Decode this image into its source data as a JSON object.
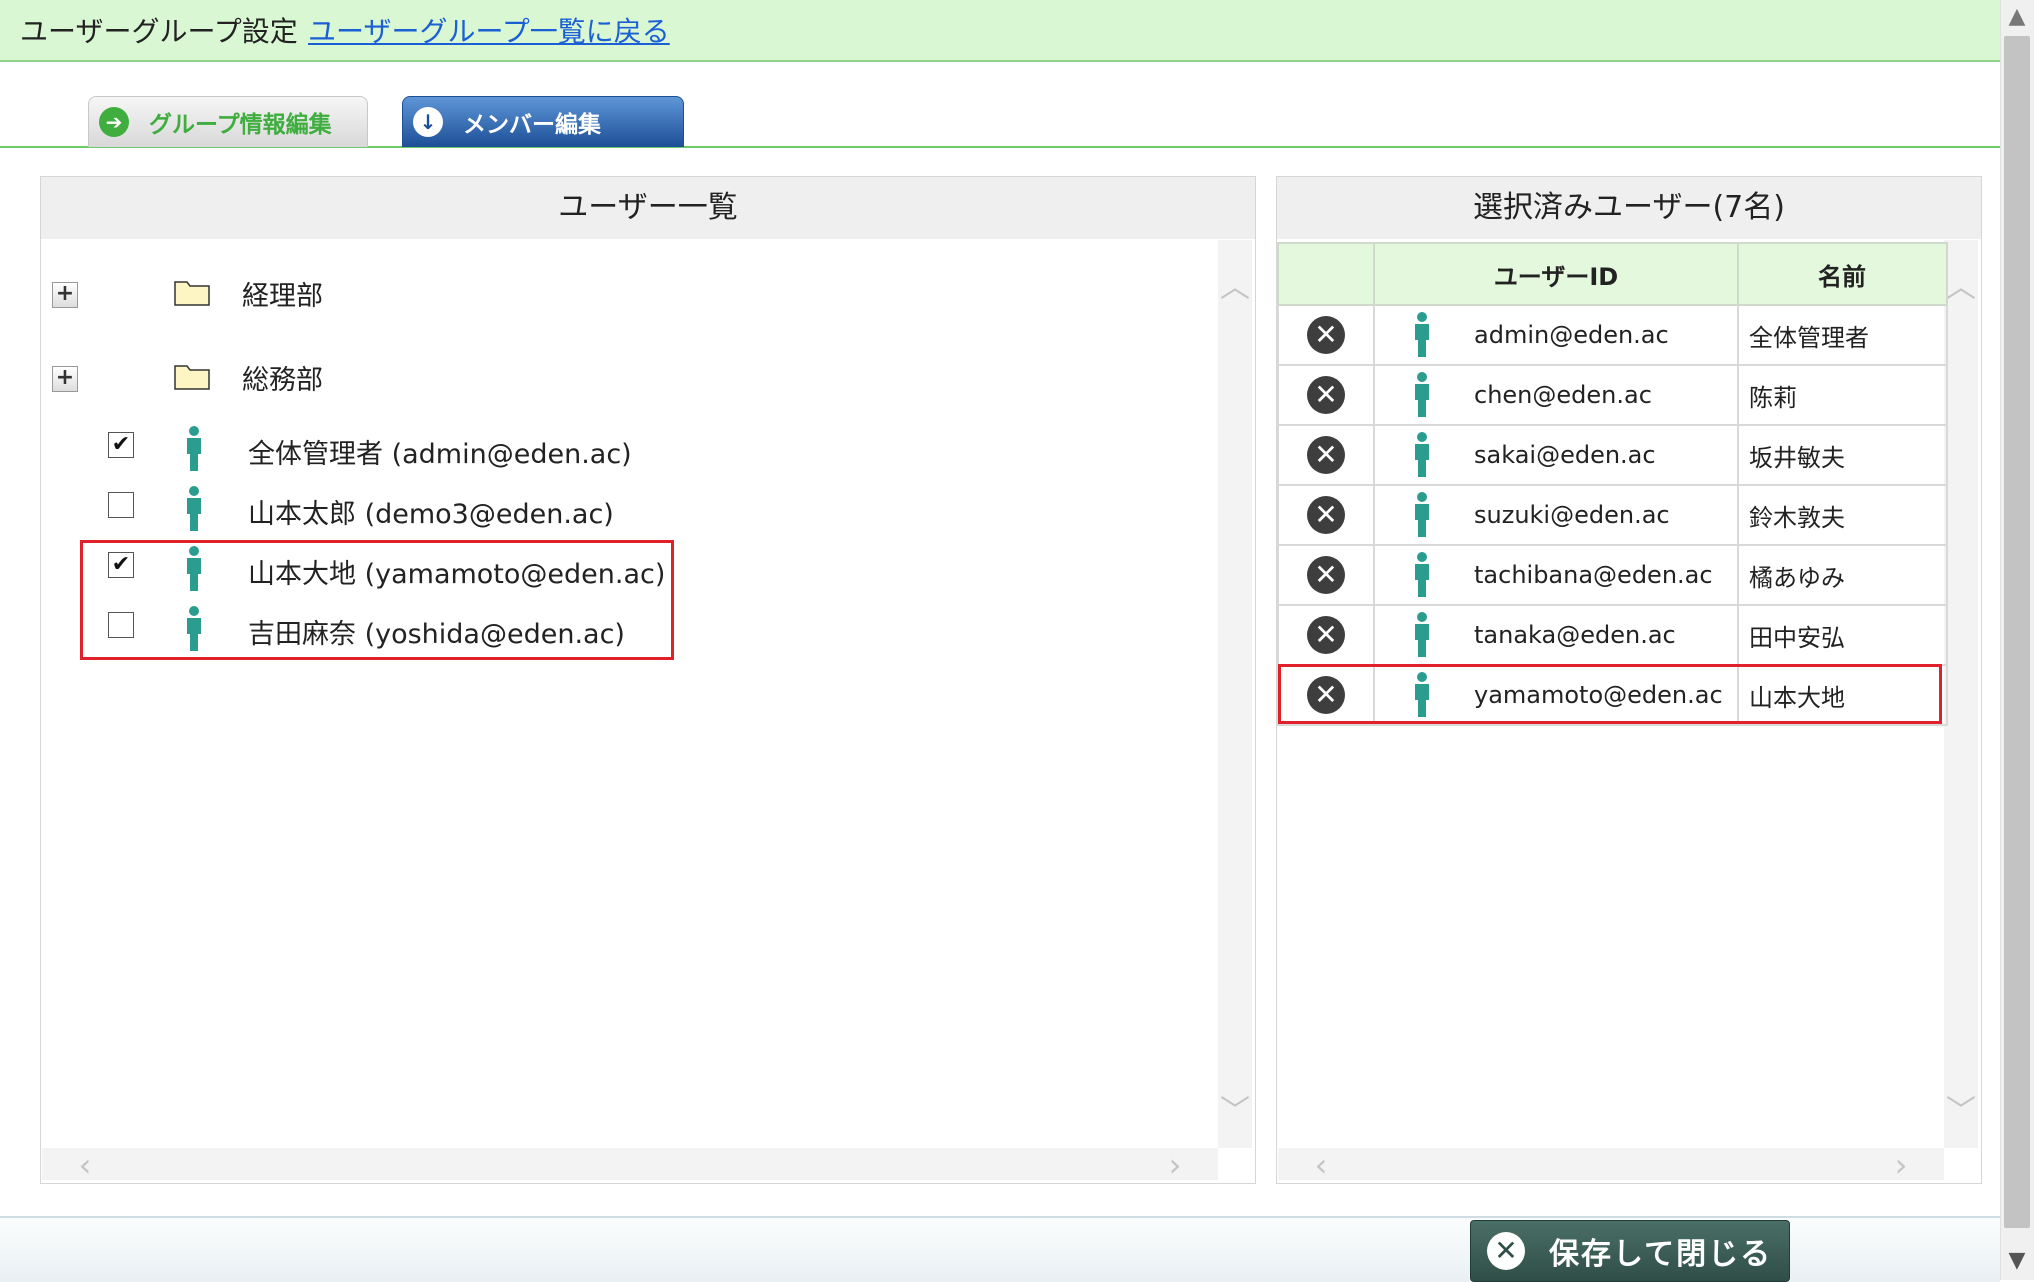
{
  "header": {
    "title": "ユーザーグループ設定",
    "back_link": "ユーザーグループ一覧に戻る"
  },
  "tabs": [
    {
      "label": "グループ情報編集",
      "icon": "arrow-right-icon",
      "active": false
    },
    {
      "label": "メンバー編集",
      "icon": "arrow-down-icon",
      "active": true
    }
  ],
  "user_list": {
    "title": "ユーザー一覧",
    "folders": [
      {
        "label": "経理部",
        "expand_symbol": "+"
      },
      {
        "label": "総務部",
        "expand_symbol": "+"
      }
    ],
    "users": [
      {
        "label": "全体管理者 (admin@eden.ac)",
        "checked": true,
        "check_mark": "✔"
      },
      {
        "label": "山本太郎 (demo3@eden.ac)",
        "checked": false,
        "check_mark": ""
      },
      {
        "label": "山本大地 (yamamoto@eden.ac)",
        "checked": true,
        "check_mark": "✔"
      },
      {
        "label": "吉田麻奈 (yoshida@eden.ac)",
        "checked": false,
        "check_mark": ""
      }
    ]
  },
  "selected_users": {
    "title": "選択済みユーザー(7名)",
    "columns": {
      "id": "ユーザーID",
      "name": "名前"
    },
    "rows": [
      {
        "id": "admin@eden.ac",
        "name": "全体管理者"
      },
      {
        "id": "chen@eden.ac",
        "name": "陈莉"
      },
      {
        "id": "sakai@eden.ac",
        "name": "坂井敏夫"
      },
      {
        "id": "suzuki@eden.ac",
        "name": "鈴木敦夫"
      },
      {
        "id": "tachibana@eden.ac",
        "name": "橘あゆみ"
      },
      {
        "id": "tanaka@eden.ac",
        "name": "田中安弘"
      },
      {
        "id": "yamamoto@eden.ac",
        "name": "山本大地"
      }
    ]
  },
  "footer": {
    "save_label": "保存して閉じる"
  },
  "colors": {
    "header_bg": "#d9f7d3",
    "link": "#1a5fd4",
    "highlight": "#e0202a",
    "person_icon": "#2a9d8f"
  }
}
